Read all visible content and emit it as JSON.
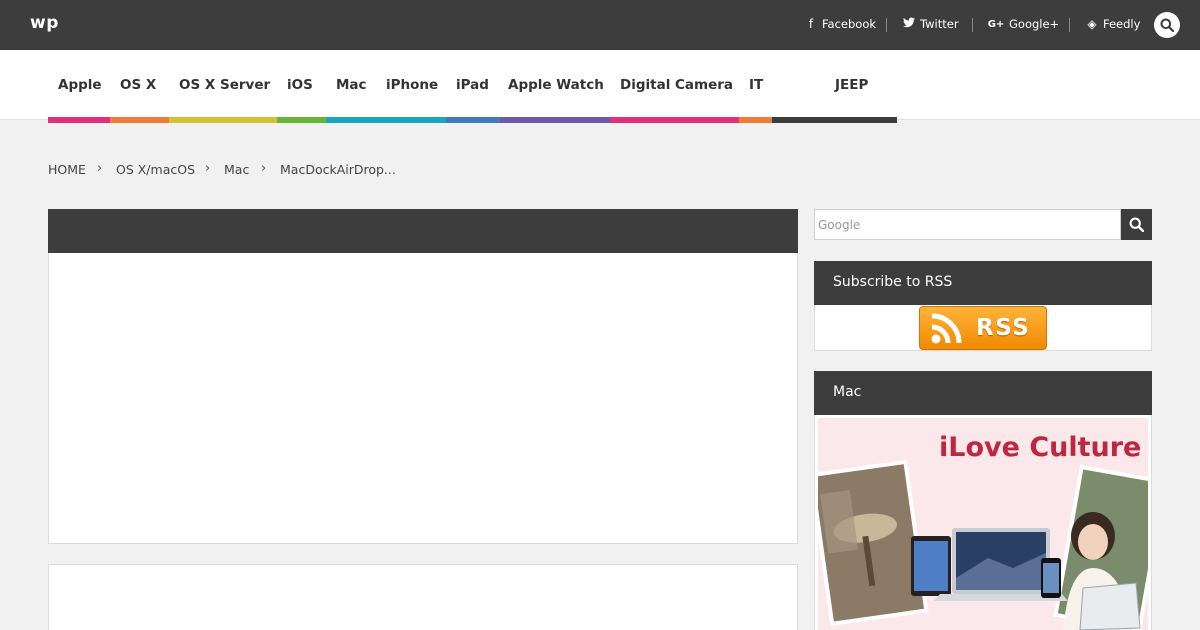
{
  "site": {
    "logo": "wp"
  },
  "social": [
    {
      "icon": "facebook-icon",
      "glyph": "f",
      "label": "Facebook"
    },
    {
      "icon": "twitter-icon",
      "glyph": "🐦",
      "label": "Twitter"
    },
    {
      "icon": "google-plus-icon",
      "glyph": "G+",
      "label": "Google+"
    },
    {
      "icon": "feedly-icon",
      "glyph": "◈",
      "label": "Feedly"
    }
  ],
  "nav": {
    "items": [
      "Apple",
      "OS X",
      "OS X Server",
      "iOS",
      "Mac",
      "iPhone",
      "iPad",
      "Apple Watch",
      "Digital Camera",
      "IT",
      "JEEP"
    ],
    "colors": [
      "#e0317b",
      "#ec7c36",
      "#d3c233",
      "#66b535",
      "#1aa6bd",
      "#3f7bb8",
      "#6b5aa8",
      "#e0317b",
      "#ec7c36",
      "#3d3d3d"
    ]
  },
  "breadcrumb": {
    "items": [
      "HOME",
      "OS X/macOS",
      "Mac",
      "MacDockAirDrop..."
    ],
    "separator": "›"
  },
  "search": {
    "placeholder": "Google"
  },
  "sidebar": {
    "rss_title": "Subscribe to RSS",
    "rss_badge": "RSS",
    "mac_title": "Mac",
    "banner_title": "iLove Culture"
  }
}
